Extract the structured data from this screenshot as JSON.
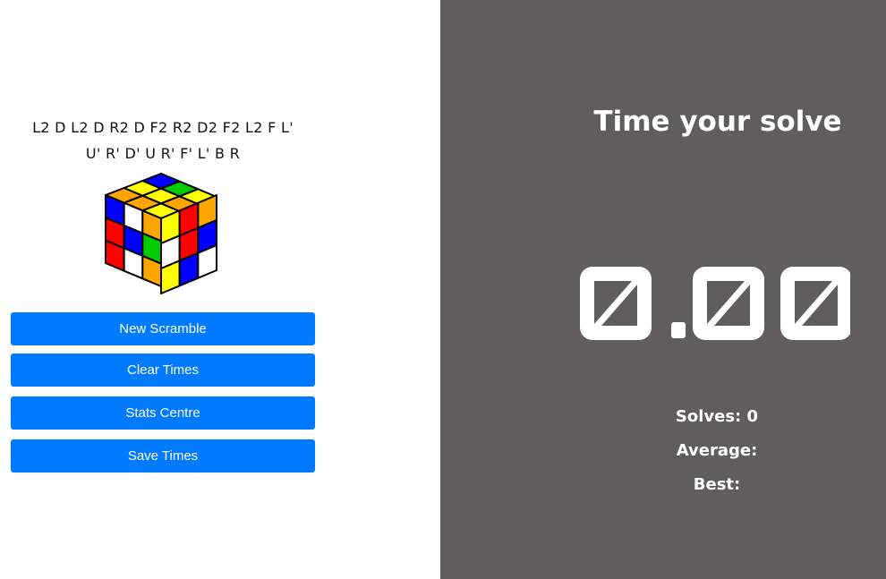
{
  "scramble": {
    "line1": "L2 D L2 D R2 D F2 R2 D2 F2 L2 F L'",
    "line2": "U' R' D' U R' F' L' B R"
  },
  "cube": {
    "top": [
      "#ffa500",
      "#ffff00",
      "#0000ff",
      "#ffa500",
      "#ffff00",
      "#00cc00",
      "#ffff00",
      "#ffa500",
      "#ffff00"
    ],
    "left": [
      "#0000ff",
      "#ffffff",
      "#ffa500",
      "#ff0000",
      "#0000ff",
      "#00cc00",
      "#ff0000",
      "#ffffff",
      "#ffa500"
    ],
    "right": [
      "#ffff00",
      "#ff0000",
      "#ffa500",
      "#ffffff",
      "#ff0000",
      "#0000ff",
      "#ffff00",
      "#0000ff",
      "#ffffff"
    ],
    "outline": "#000000"
  },
  "buttons": {
    "new_scramble": "New Scramble",
    "clear_times": "Clear Times",
    "stats_centre": "Stats Centre",
    "save_times": "Save Times"
  },
  "timer": {
    "heading": "Time your solve",
    "display": "0.00"
  },
  "stats": {
    "solves_label": "Solves:",
    "solves_value": "0",
    "average_label": "Average:",
    "average_value": "",
    "best_label": "Best:",
    "best_value": ""
  },
  "colors": {
    "accent": "#007bff",
    "right_panel_bg": "#5f5d5e",
    "timer_digit": "#ffffff"
  }
}
